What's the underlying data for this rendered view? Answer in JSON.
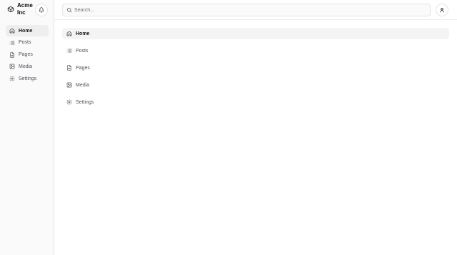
{
  "brand": {
    "name_line1": "Acme",
    "name_line2": "Inc",
    "logo_icon": "package-icon"
  },
  "header": {
    "notifications_icon": "bell-icon",
    "search": {
      "placeholder": "Search...",
      "value": "",
      "icon": "search-icon"
    },
    "user_icon": "user-icon"
  },
  "sidebar": {
    "items": [
      {
        "label": "Home",
        "icon": "home-icon",
        "active": true
      },
      {
        "label": "Posts",
        "icon": "list-icon",
        "active": false
      },
      {
        "label": "Pages",
        "icon": "file-icon",
        "active": false
      },
      {
        "label": "Media",
        "icon": "image-icon",
        "active": false
      },
      {
        "label": "Settings",
        "icon": "gear-icon",
        "active": false
      }
    ]
  },
  "main": {
    "items": [
      {
        "label": "Home",
        "icon": "home-icon",
        "active": true
      },
      {
        "label": "Posts",
        "icon": "list-icon",
        "active": false
      },
      {
        "label": "Pages",
        "icon": "file-icon",
        "active": false
      },
      {
        "label": "Media",
        "icon": "image-icon",
        "active": false
      },
      {
        "label": "Settings",
        "icon": "gear-icon",
        "active": false
      }
    ]
  },
  "colors": {
    "active_bg": "#eeeeef",
    "border": "#e4e4e7",
    "text": "#18181b",
    "muted": "#52525b"
  }
}
